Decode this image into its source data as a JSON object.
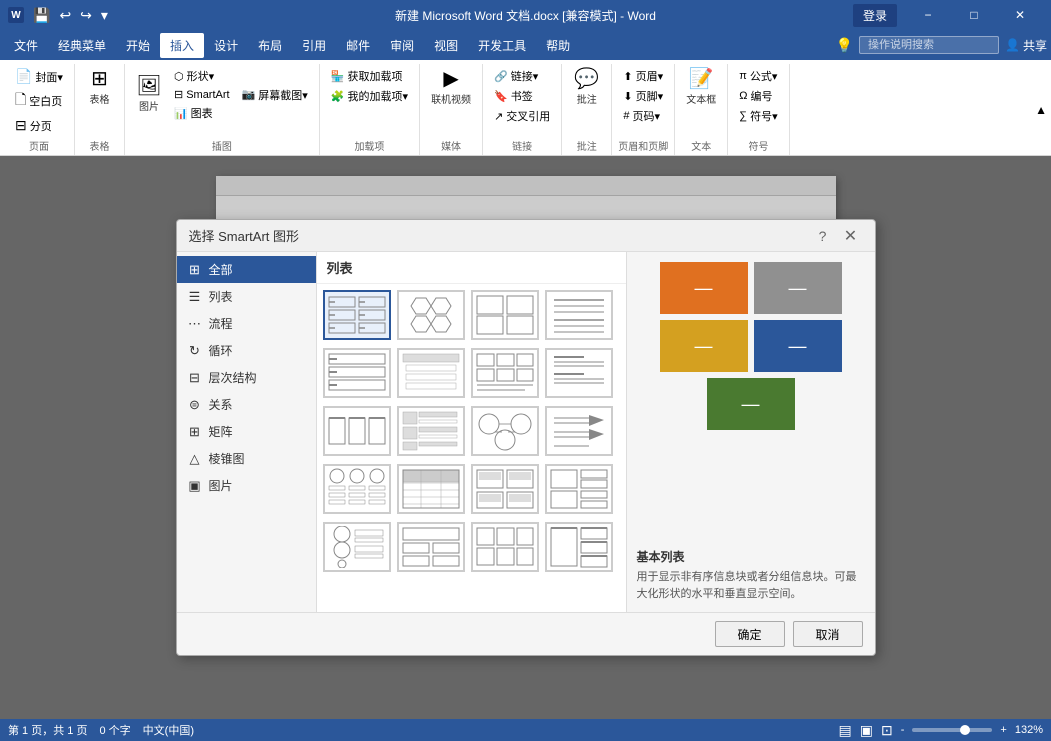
{
  "titleBar": {
    "title": "新建 Microsoft Word 文档.docx [兼容模式] - Word",
    "loginBtn": "登录",
    "saveIcon": "💾",
    "undoIcon": "↩",
    "redoIcon": "↪"
  },
  "menuBar": {
    "items": [
      "文件",
      "经典菜单",
      "开始",
      "插入",
      "设计",
      "布局",
      "引用",
      "邮件",
      "审阅",
      "视图",
      "开发工具",
      "帮助"
    ],
    "activeItem": "插入",
    "searchPlaceholder": "操作说明搜索",
    "shareLabel": "共享"
  },
  "ribbon": {
    "groups": [
      {
        "name": "页面",
        "label": "页面",
        "buttons": [
          "封面",
          "空白页",
          "分页"
        ]
      },
      {
        "name": "表格",
        "label": "表格",
        "buttons": [
          "表格"
        ]
      },
      {
        "name": "插图",
        "label": "插图",
        "buttons": [
          "图片",
          "形状",
          "SmartArt",
          "图表",
          "屏幕截图"
        ]
      },
      {
        "name": "加载项",
        "label": "加载项",
        "buttons": [
          "获取加载项",
          "我的加载项"
        ]
      },
      {
        "name": "媒体",
        "label": "媒体",
        "buttons": [
          "联机视频"
        ]
      },
      {
        "name": "链接",
        "label": "链接",
        "buttons": [
          "链接",
          "书签",
          "交叉引用"
        ]
      },
      {
        "name": "批注",
        "label": "批注",
        "buttons": [
          "批注"
        ]
      },
      {
        "name": "页眉和页脚",
        "label": "页眉和页脚",
        "buttons": [
          "页眉",
          "页脚",
          "页码"
        ]
      },
      {
        "name": "文本",
        "label": "文本",
        "buttons": [
          "文本框"
        ]
      },
      {
        "name": "符号",
        "label": "符号",
        "buttons": [
          "公式",
          "编号",
          "符号"
        ]
      }
    ]
  },
  "dialog": {
    "title": "选择 SmartArt 图形",
    "categories": [
      {
        "label": "全部",
        "icon": "⊞",
        "active": true
      },
      {
        "label": "列表",
        "icon": "☰"
      },
      {
        "label": "流程",
        "icon": "⋯"
      },
      {
        "label": "循环",
        "icon": "↻"
      },
      {
        "label": "层次结构",
        "icon": "⊟"
      },
      {
        "label": "关系",
        "icon": "⊜"
      },
      {
        "label": "矩阵",
        "icon": "⊞"
      },
      {
        "label": "棱锥图",
        "icon": "△"
      },
      {
        "label": "图片",
        "icon": "▣"
      }
    ],
    "listPanelTitle": "列表",
    "previewTitle": "基本列表",
    "previewDesc": "用于显示非有序信息块或者分组信息块。可最大化形状的水平和垂直显示空间。",
    "confirmBtn": "确定",
    "cancelBtn": "取消",
    "previewColors": [
      {
        "color": "#e07020",
        "row": 0,
        "col": 0
      },
      {
        "color": "#909090",
        "row": 0,
        "col": 1
      },
      {
        "color": "#d4a020",
        "row": 1,
        "col": 0
      },
      {
        "color": "#2b579a",
        "row": 1,
        "col": 1
      },
      {
        "color": "#4a7a30",
        "row": 2,
        "col": 0
      }
    ]
  },
  "statusBar": {
    "page": "第 1 页，共 1 页",
    "words": "0 个字",
    "lang": "中文(中国)",
    "zoom": "132%",
    "zoomMinus": "-",
    "zoomPlus": "+"
  }
}
